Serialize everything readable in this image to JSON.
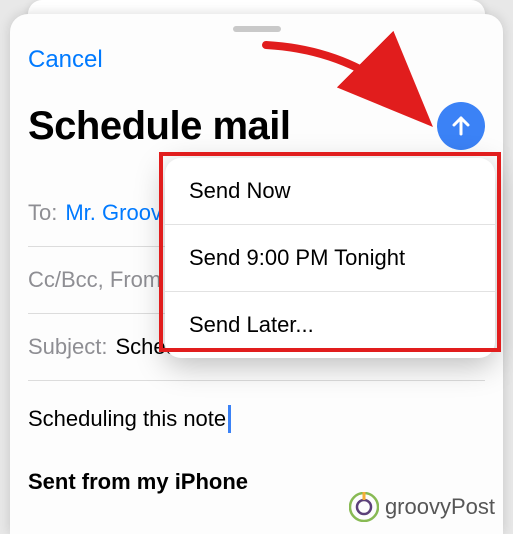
{
  "header": {
    "cancel": "Cancel",
    "title": "Schedule mail"
  },
  "fields": {
    "to_label": "To:",
    "to_value": "Mr. Groov",
    "cc_label": "Cc/Bcc, From",
    "subject_label": "Subject:",
    "subject_value": "Schedule mail"
  },
  "body": {
    "text": "Scheduling this note",
    "signature": "Sent from my iPhone"
  },
  "popup": {
    "items": [
      "Send Now",
      "Send 9:00 PM Tonight",
      "Send Later..."
    ]
  },
  "watermark": {
    "text": "groovyPost"
  }
}
